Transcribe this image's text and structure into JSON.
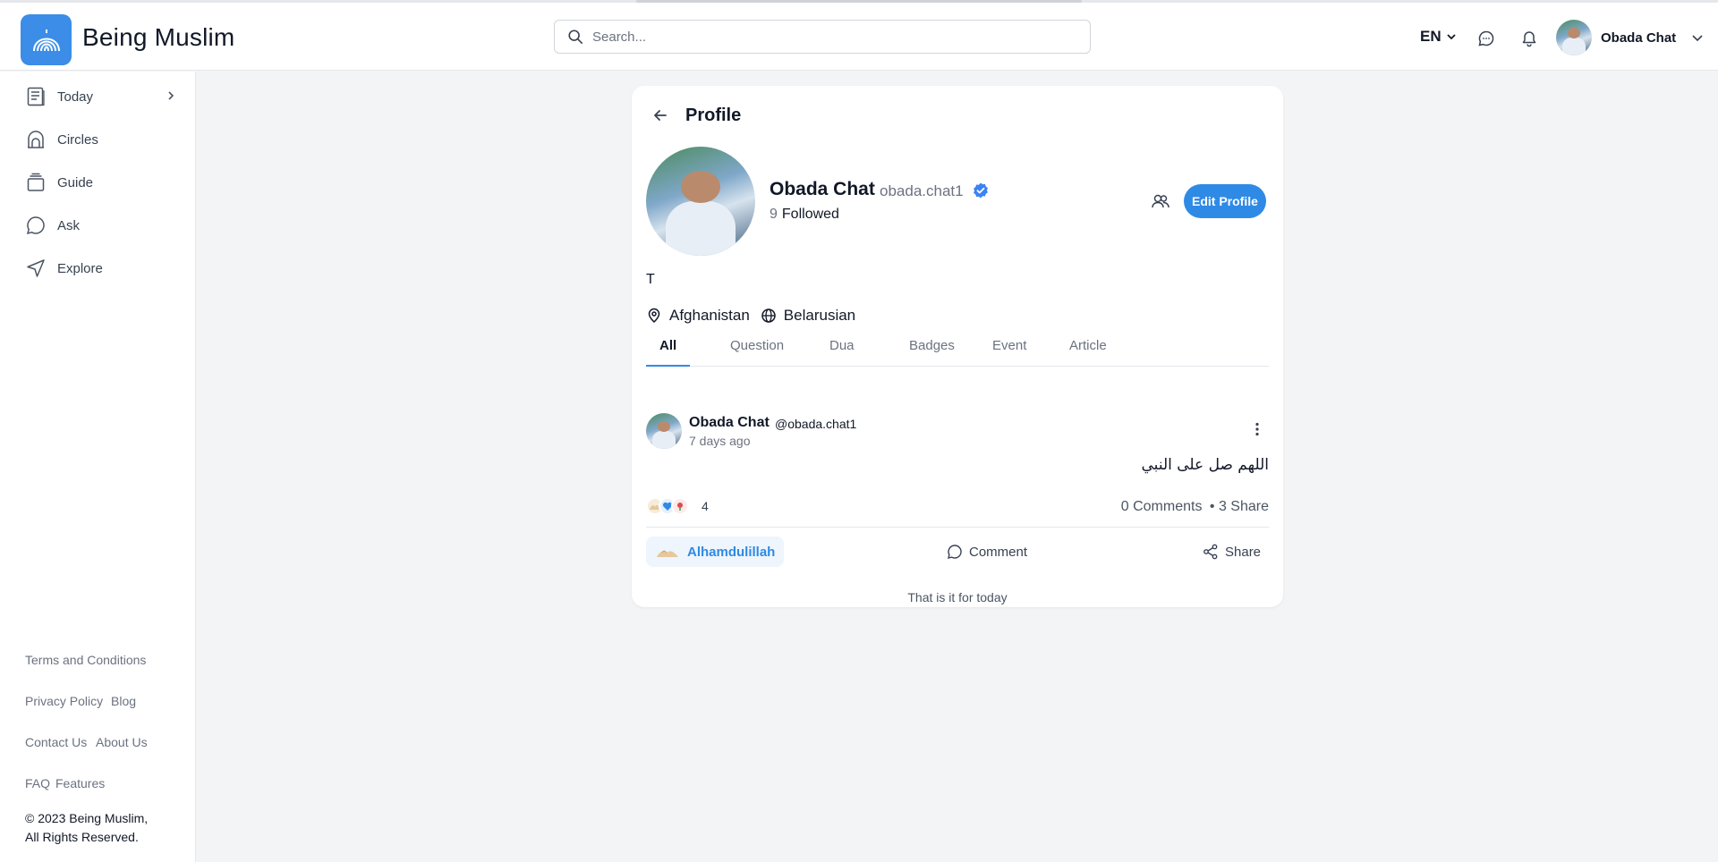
{
  "header": {
    "brand": "Being Muslim",
    "search_placeholder": "Search...",
    "lang": "EN",
    "user_name": "Obada Chat"
  },
  "sidebar": {
    "items": [
      {
        "label": "Today",
        "icon": "today-doc-icon"
      },
      {
        "label": "Circles",
        "icon": "home-arch-icon"
      },
      {
        "label": "Guide",
        "icon": "layers-icon"
      },
      {
        "label": "Ask",
        "icon": "chat-bubble-icon"
      },
      {
        "label": "Explore",
        "icon": "navigation-arrow-icon"
      }
    ],
    "footer": {
      "terms": "Terms and Conditions",
      "privacy": "Privacy Policy",
      "blog": "Blog",
      "contact": "Contact Us",
      "about": "About Us",
      "faq": "FAQ",
      "features": "Features",
      "copyright_1": "© 2023 Being Muslim,",
      "copyright_2": "All Rights Reserved."
    }
  },
  "profile": {
    "title": "Profile",
    "name": "Obada Chat",
    "handle": "obada.chat1",
    "followed_count": "9",
    "followed_label": "Followed",
    "edit_label": "Edit Profile",
    "bio": "T",
    "location": "Afghanistan",
    "language": "Belarusian",
    "tabs": [
      "All",
      "Question",
      "Dua",
      "Badges",
      "Event",
      "Article"
    ],
    "active_tab": "All"
  },
  "post": {
    "author": "Obada Chat",
    "handle": "@obada.chat1",
    "time": "7 days ago",
    "text": "اللهم صل على النبي",
    "reaction_count": "4",
    "comments": "0 Comments",
    "shares": "• 3 Share",
    "alhamdulillah_label": "Alhamdulillah",
    "comment_label": "Comment",
    "share_label": "Share"
  },
  "feed_end": "That is it for today",
  "colors": {
    "accent": "#2f8ae6",
    "verified": "#3b82f6",
    "background": "#f3f4f6"
  }
}
